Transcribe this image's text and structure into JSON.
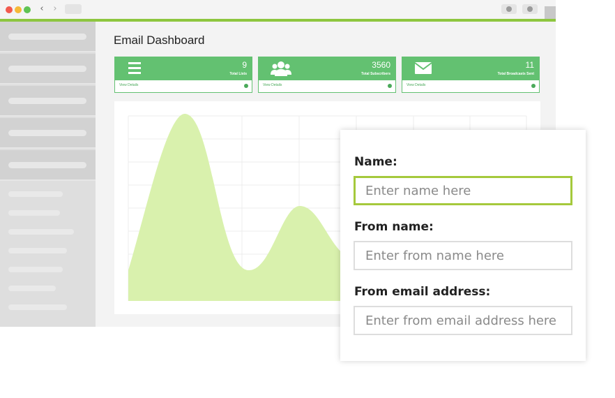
{
  "app": {
    "page_title": "Email Dashboard"
  },
  "stats": [
    {
      "value": "9",
      "label": "Total Lists",
      "link": "View Details",
      "icon": "list-icon"
    },
    {
      "value": "3560",
      "label": "Total Subscribers",
      "link": "View Details",
      "icon": "users-icon"
    },
    {
      "value": "11",
      "label": "Total Broadcasts Sent",
      "link": "View Details",
      "icon": "envelope-icon"
    }
  ],
  "colors": {
    "accent": "#8dc63f",
    "card_green": "#63c171",
    "chart_fill": "#d9f1ad",
    "active_border": "#a5c93c"
  },
  "form": {
    "name_label": "Name:",
    "name_placeholder": "Enter name here",
    "from_name_label": "From name:",
    "from_name_placeholder": "Enter from name here",
    "from_email_label": "From email address:",
    "from_email_placeholder": "Enter from email address here"
  }
}
